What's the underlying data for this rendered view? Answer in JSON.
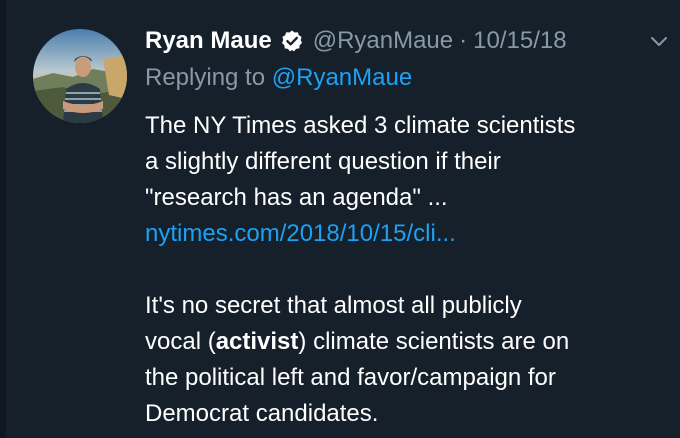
{
  "tweet": {
    "author_name": "Ryan Maue",
    "handle": "@RyanMaue",
    "separator": "·",
    "date": "10/15/18",
    "reply_prefix": "Replying to",
    "reply_mention": "@RyanMaue",
    "text": {
      "line1": "The NY Times asked 3 climate scientists",
      "line2": "a slightly different question if their",
      "line3": "\"research has an agenda\" ...",
      "link": "nytimes.com/2018/10/15/cli...",
      "line5": "It's no secret that almost all publicly",
      "line6_pre": "vocal (",
      "line6_bold": "activist",
      "line6_post": ") climate scientists are on",
      "line7": "the political left and favor/campaign for",
      "line8": "Democrat candidates."
    }
  },
  "icons": {
    "verified": "verified-badge-icon",
    "caret": "chevron-down-icon"
  },
  "colors": {
    "background": "#15202b",
    "text": "#ffffff",
    "muted": "#8899a6",
    "link": "#1da1f2"
  }
}
